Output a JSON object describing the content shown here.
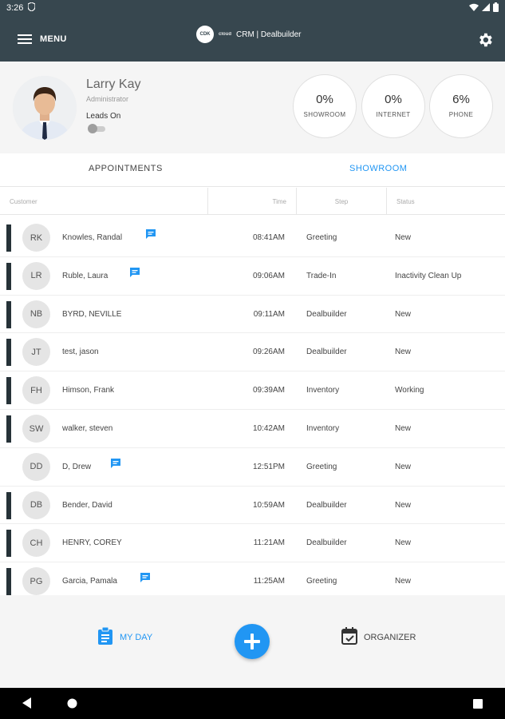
{
  "statusbar": {
    "time": "3:26"
  },
  "appbar": {
    "menu_label": "MENU",
    "brand_logo": "CDK",
    "brand_sub": "cloud",
    "title": "CRM | Dealbuilder"
  },
  "profile": {
    "name": "Larry Kay",
    "role": "Administrator",
    "leads_label": "Leads On",
    "leads_on": false,
    "stats": [
      {
        "value": "0%",
        "label": "SHOWROOM"
      },
      {
        "value": "0%",
        "label": "INTERNET"
      },
      {
        "value": "6%",
        "label": "PHONE"
      }
    ]
  },
  "tabs": [
    {
      "label": "APPOINTMENTS",
      "active": false
    },
    {
      "label": "SHOWROOM",
      "active": true
    }
  ],
  "table": {
    "headers": {
      "customer": "Customer",
      "time": "Time",
      "step": "Step",
      "status": "Status"
    },
    "rows": [
      {
        "initials": "RK",
        "name": "Knowles, Randal",
        "time": "08:41AM",
        "step": "Greeting",
        "status": "New",
        "has_chat": true,
        "has_bar": true
      },
      {
        "initials": "LR",
        "name": "Ruble, Laura",
        "time": "09:06AM",
        "step": "Trade-In",
        "status": "Inactivity Clean Up",
        "has_chat": true,
        "has_bar": true
      },
      {
        "initials": "NB",
        "name": "BYRD, NEVILLE",
        "time": "09:11AM",
        "step": "Dealbuilder",
        "status": "New",
        "has_chat": false,
        "has_bar": true
      },
      {
        "initials": "JT",
        "name": "test, jason",
        "time": "09:26AM",
        "step": "Dealbuilder",
        "status": "New",
        "has_chat": false,
        "has_bar": true
      },
      {
        "initials": "FH",
        "name": "Himson, Frank",
        "time": "09:39AM",
        "step": "Inventory",
        "status": "Working",
        "has_chat": false,
        "has_bar": true
      },
      {
        "initials": "SW",
        "name": "walker, steven",
        "time": "10:42AM",
        "step": "Inventory",
        "status": "New",
        "has_chat": false,
        "has_bar": true
      },
      {
        "initials": "DD",
        "name": "D, Drew",
        "time": "12:51PM",
        "step": "Greeting",
        "status": "New",
        "has_chat": true,
        "has_bar": false
      },
      {
        "initials": "DB",
        "name": "Bender, David",
        "time": "10:59AM",
        "step": "Dealbuilder",
        "status": "New",
        "has_chat": false,
        "has_bar": true
      },
      {
        "initials": "CH",
        "name": "HENRY, COREY",
        "time": "11:21AM",
        "step": "Dealbuilder",
        "status": "New",
        "has_chat": false,
        "has_bar": true
      },
      {
        "initials": "PG",
        "name": "Garcia, Pamala",
        "time": "11:25AM",
        "step": "Greeting",
        "status": "New",
        "has_chat": true,
        "has_bar": true
      }
    ]
  },
  "bottom": {
    "myday_label": "MY DAY",
    "organizer_label": "ORGANIZER",
    "fab_icon": "plus-icon"
  },
  "colors": {
    "appbar": "#37474f",
    "accent": "#2196f3",
    "bar": "#263238",
    "background": "#f5f5f5"
  },
  "icons": {
    "menu": "hamburger-icon",
    "settings": "gear-icon",
    "chat": "chat-bubble-icon",
    "myday": "clipboard-icon",
    "organizer": "calendar-icon",
    "nav_back": "back-triangle-icon",
    "nav_home": "home-circle-icon",
    "nav_recents": "recents-square-icon"
  }
}
